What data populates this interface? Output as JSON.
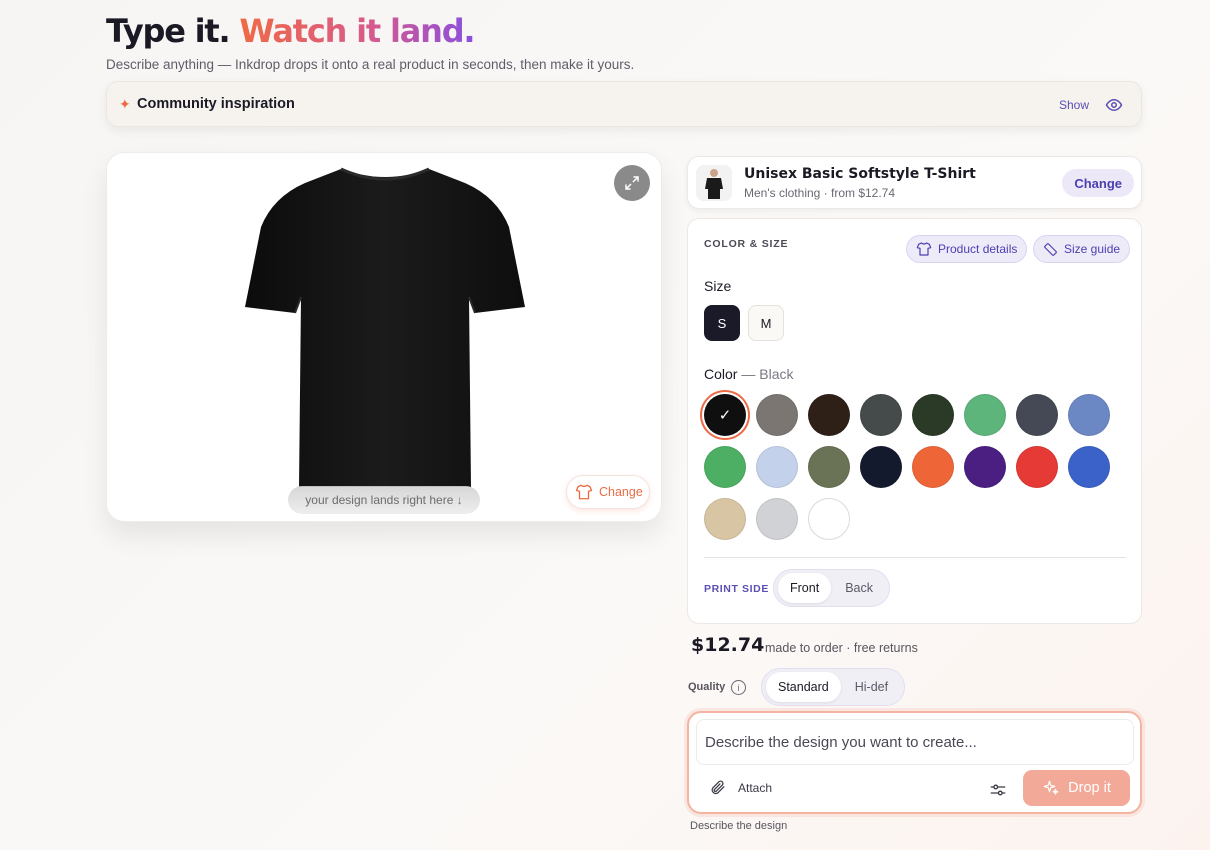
{
  "hero": {
    "title_part1": "Type it. ",
    "title_part2": "Watch it land.",
    "subtitle": "Describe anything — Inkdrop drops it onto a real product in seconds, then make it yours."
  },
  "community": {
    "label": "Community inspiration",
    "show_label": "Show"
  },
  "preview": {
    "lands_text": "your design lands right here ↓",
    "change_label": "Change"
  },
  "product": {
    "name": "Unisex Basic Softstyle T-Shirt",
    "meta": "Men's clothing · from $12.74",
    "change_label": "Change"
  },
  "options": {
    "title": "COLOR & SIZE",
    "product_details_label": "Product details",
    "size_guide_label": "Size guide",
    "size_label": "Size",
    "sizes": [
      "S",
      "M"
    ],
    "selected_size": "S",
    "color_label": "Color",
    "color_separator": " — ",
    "selected_color_name": "Black",
    "colors": [
      "#0f0f10",
      "#7b7671",
      "#2e2017",
      "#454a4a",
      "#2a3a27",
      "#5db57b",
      "#444955",
      "#6c88c4",
      "#4caf63",
      "#c3d1ea",
      "#6a7355",
      "#141a2e",
      "#ee6637",
      "#4b1f82",
      "#e53a36",
      "#3b62c8",
      "#d8c5a4",
      "#d1d2d5",
      "#ffffff"
    ],
    "print_side_label": "PRINT SIDE",
    "print_sides": [
      "Front",
      "Back"
    ],
    "selected_print_side": "Front"
  },
  "pricing": {
    "price": "$12.74",
    "note": "made to order · free returns",
    "quality_label": "Quality",
    "quality_options": [
      "Standard",
      "Hi-def"
    ],
    "selected_quality": "Standard"
  },
  "prompt": {
    "placeholder": "Describe the design you want to create...",
    "value": "",
    "attach_label": "Attach",
    "drop_label": "Drop it",
    "footer_note": "Describe the design"
  },
  "icons": {
    "community": "sparkle-icon",
    "show": "eye-icon",
    "expand": "expand-icon",
    "preview_change": "shirt-icon",
    "product_details": "shirt-icon",
    "size_guide": "ruler-icon",
    "quality_info": "info-icon",
    "attach": "paperclip-icon",
    "settings": "sliders-icon",
    "drop": "sparkles-icon"
  },
  "colors_accent": {
    "brand_orange": "#ec6b47",
    "brand_purple": "#5b4fb4",
    "drop_button": "#f3a998"
  }
}
